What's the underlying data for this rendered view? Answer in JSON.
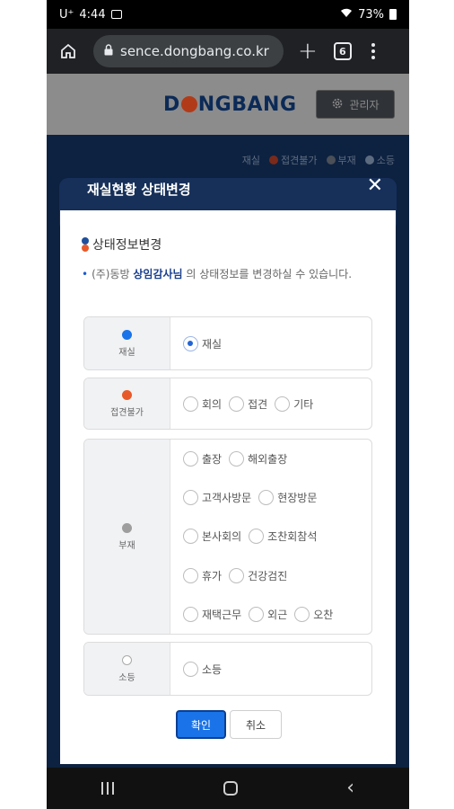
{
  "status_bar": {
    "carrier": "U⁺",
    "time": "4:44",
    "battery": "73%"
  },
  "browser": {
    "url": "sence.dongbang.co.kr",
    "tab_count": "6"
  },
  "site": {
    "logo": {
      "part1": "D",
      "part2": "NGBANG"
    },
    "admin_label": "관리자",
    "legend": [
      "재실",
      "접견불가",
      "부재",
      "소등"
    ]
  },
  "dialog": {
    "title": "재실현황 상태변경",
    "section_title": "상태정보변경",
    "desc_prefix": "(주)동방 ",
    "desc_name": "상임감사님",
    "desc_suffix": " 의 상태정보를 변경하실 수 있습니다.",
    "groups": {
      "present": {
        "label": "재실",
        "options": [
          "재실"
        ]
      },
      "no_meeting": {
        "label": "접견불가",
        "options": [
          "회의",
          "접견",
          "기타"
        ]
      },
      "absent": {
        "label": "부재",
        "rows": [
          [
            "출장",
            "해외출장"
          ],
          [
            "고객사방문",
            "현장방문"
          ],
          [
            "본사회의",
            "조찬회참석"
          ],
          [
            "휴가",
            "건강검진"
          ],
          [
            "재택근무",
            "외근",
            "오찬"
          ]
        ]
      },
      "off": {
        "label": "소등",
        "options": [
          "소등"
        ]
      }
    },
    "selected": "재실",
    "ok_label": "확인",
    "cancel_label": "취소"
  },
  "colors": {
    "present": "#1a73e8",
    "no_meeting": "#e8592a",
    "absent": "#9e9e9e",
    "off": "#ffffff",
    "accent": "#1a73e8"
  }
}
